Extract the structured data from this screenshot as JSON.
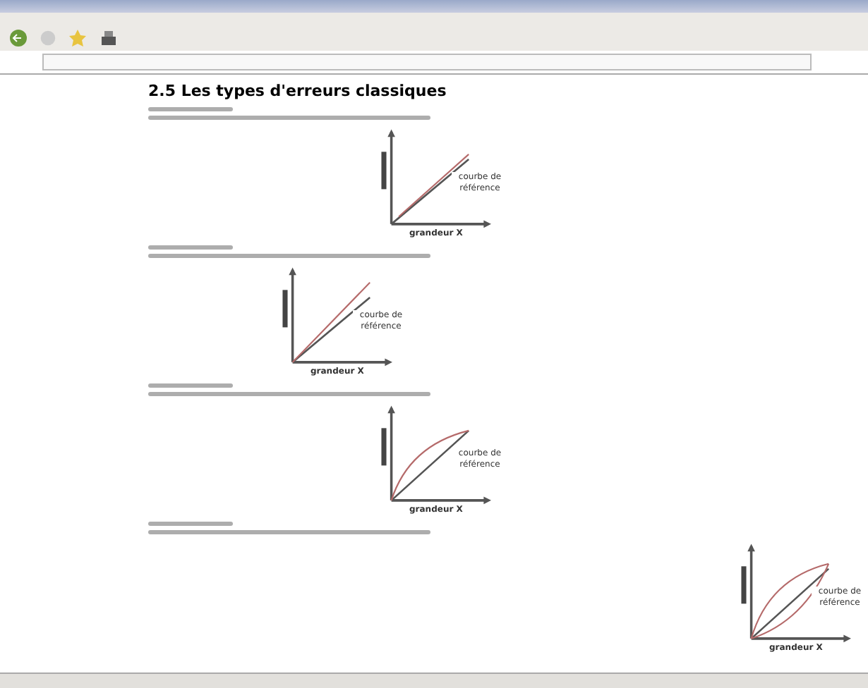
{
  "page": {
    "heading": "2.5 Les types d'erreurs classiques"
  },
  "sections": [
    {
      "chart": {
        "kind": "offset",
        "curve_label": "courbe de référence",
        "axis_label": "grandeur X"
      }
    },
    {
      "chart": {
        "kind": "gain",
        "curve_label": "courbe de référence",
        "axis_label": "grandeur X"
      }
    },
    {
      "chart": {
        "kind": "curve",
        "curve_label": "courbe de référence",
        "axis_label": "grandeur X"
      }
    },
    {
      "chart": {
        "kind": "hysteresis",
        "curve_label": "courbe de référence",
        "axis_label": "grandeur X"
      }
    }
  ]
}
